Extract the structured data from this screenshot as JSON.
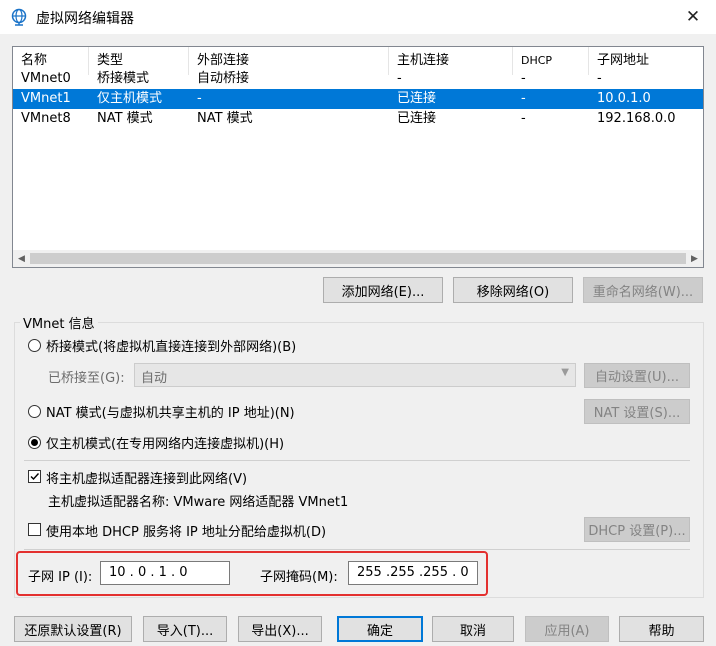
{
  "window": {
    "title": "虚拟网络编辑器",
    "icon": "network-globe-icon",
    "close_glyph": "✕"
  },
  "network_list": {
    "columns": [
      "名称",
      "类型",
      "外部连接",
      "主机连接",
      "DHCP",
      "子网地址"
    ],
    "rows": [
      {
        "name": "VMnet0",
        "type": "桥接模式",
        "external": "自动桥接",
        "host": "-",
        "dhcp": "-",
        "subnet": "-",
        "selected": false
      },
      {
        "name": "VMnet1",
        "type": "仅主机模式",
        "external": "-",
        "host": "已连接",
        "dhcp": "-",
        "subnet": "10.0.1.0",
        "selected": true
      },
      {
        "name": "VMnet8",
        "type": "NAT 模式",
        "external": "NAT 模式",
        "host": "已连接",
        "dhcp": "-",
        "subnet": "192.168.0.0",
        "selected": false
      }
    ]
  },
  "list_buttons": {
    "add": "添加网络(E)...",
    "remove": "移除网络(O)",
    "rename": "重命名网络(W)..."
  },
  "vmnet_info": {
    "group_title": "VMnet 信息",
    "bridged_label": "桥接模式(将虚拟机直接连接到外部网络)(B)",
    "bridged_to_label": "已桥接至(G):",
    "bridged_to_value": "自动",
    "auto_settings": "自动设置(U)...",
    "nat_label": "NAT 模式(与虚拟机共享主机的 IP 地址)(N)",
    "nat_settings": "NAT 设置(S)...",
    "hostonly_label": "仅主机模式(在专用网络内连接虚拟机)(H)",
    "connect_adapter_label": "将主机虚拟适配器连接到此网络(V)",
    "adapter_name_label": "主机虚拟适配器名称: VMware 网络适配器 VMnet1",
    "dhcp_label": "使用本地 DHCP 服务将 IP 地址分配给虚拟机(D)",
    "dhcp_settings": "DHCP 设置(P)...",
    "subnet_ip_label": "子网 IP (I):",
    "subnet_ip_value": "10 . 0 . 1 . 0",
    "subnet_mask_label": "子网掩码(M):",
    "subnet_mask_value": "255 .255 .255 . 0",
    "selected_mode": "hostonly",
    "connect_adapter_checked": true,
    "dhcp_checked": false
  },
  "bottom_buttons": {
    "restore": "还原默认设置(R)",
    "import": "导入(T)...",
    "export": "导出(X)...",
    "ok": "确定",
    "cancel": "取消",
    "apply": "应用(A)",
    "help": "帮助"
  },
  "colors": {
    "selection": "#0078d7",
    "highlight_border": "#e3302f",
    "icon_blue": "#1a73c8"
  }
}
